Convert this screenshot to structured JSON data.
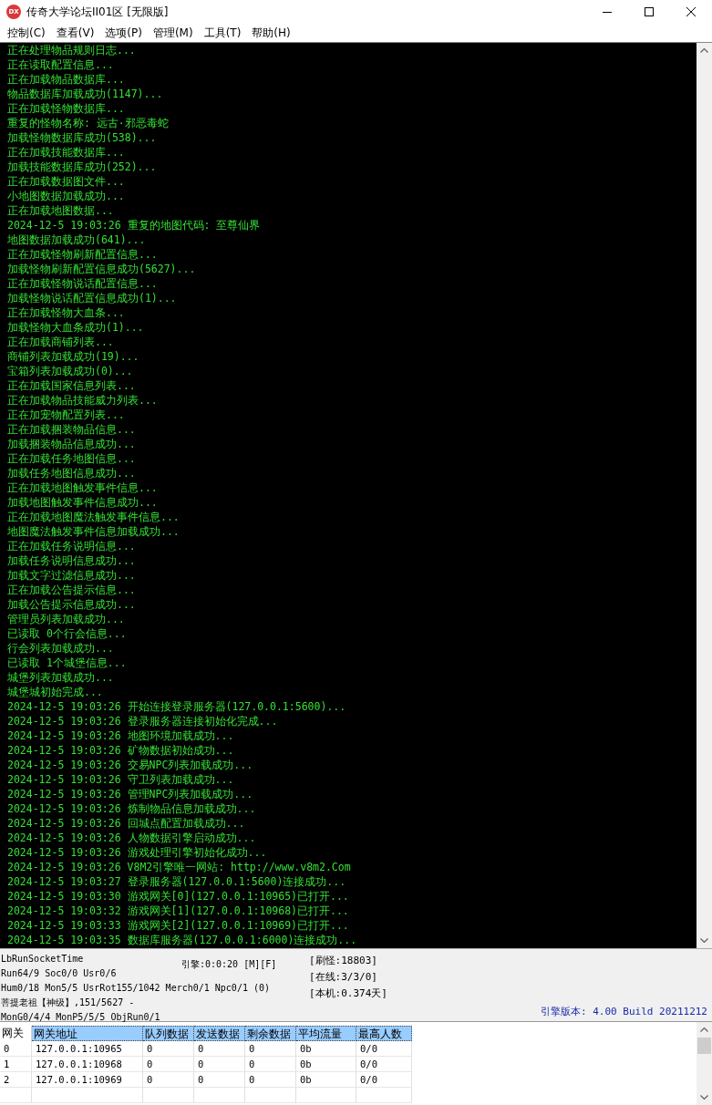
{
  "window": {
    "title": "传奇大学论坛II01区 [无限版]",
    "icon_label": "DX"
  },
  "menu": [
    "控制(C)",
    "查看(V)",
    "选项(P)",
    "管理(M)",
    "工具(T)",
    "帮助(H)"
  ],
  "log": [
    "正在处理物品规则日志...",
    "正在读取配置信息...",
    "正在加载物品数据库...",
    "物品数据库加载成功(1147)...",
    "正在加载怪物数据库...",
    "重复的怪物名称: 远古·邪恶毒蛇",
    "加载怪物数据库成功(538)...",
    "正在加载技能数据库...",
    "加载技能数据库成功(252)...",
    "正在加载数据图文件...",
    "小地图数据加载成功...",
    "正在加载地图数据...",
    "2024-12-5 19:03:26 重复的地图代码: 至尊仙界",
    "地图数据加载成功(641)...",
    "正在加载怪物刷新配置信息...",
    "加载怪物刷新配置信息成功(5627)...",
    "正在加载怪物说话配置信息...",
    "加载怪物说话配置信息成功(1)...",
    "正在加载怪物大血条...",
    "加载怪物大血条成功(1)...",
    "正在加载商铺列表...",
    "商铺列表加载成功(19)...",
    "宝箱列表加载成功(0)...",
    "正在加载国家信息列表...",
    "正在加载物品技能威力列表...",
    "正在加宠物配置列表...",
    "正在加载捆装物品信息...",
    "加载捆装物品信息成功...",
    "正在加载任务地图信息...",
    "加载任务地图信息成功...",
    "正在加载地图触发事件信息...",
    "加载地图触发事件信息成功...",
    "正在加载地图魔法触发事件信息...",
    "地图魔法触发事件信息加载成功...",
    "正在加载任务说明信息...",
    "加载任务说明信息成功...",
    "加载文字过滤信息成功...",
    "正在加载公告提示信息...",
    "加载公告提示信息成功...",
    "管理员列表加载成功...",
    "已读取 0个行会信息...",
    "行会列表加载成功...",
    "已读取 1个城堡信息...",
    "城堡列表加载成功...",
    "城堡城初始完成...",
    "2024-12-5 19:03:26 开始连接登录服务器(127.0.0.1:5600)...",
    "2024-12-5 19:03:26 登录服务器连接初始化完成...",
    "2024-12-5 19:03:26 地图环境加载成功...",
    "2024-12-5 19:03:26 矿物数据初始成功...",
    "2024-12-5 19:03:26 交易NPC列表加载成功...",
    "2024-12-5 19:03:26 守卫列表加载成功...",
    "2024-12-5 19:03:26 管理NPC列表加载成功...",
    "2024-12-5 19:03:26 炼制物品信息加载成功...",
    "2024-12-5 19:03:26 回城点配置加载成功...",
    "2024-12-5 19:03:26 人物数据引擎启动成功...",
    "2024-12-5 19:03:26 游戏处理引擎初始化成功...",
    "2024-12-5 19:03:26 V8M2引擎唯一网站: http://www.v8m2.Com",
    "2024-12-5 19:03:27 登录服务器(127.0.0.1:5600)连接成功...",
    "2024-12-5 19:03:30 游戏网关[0](127.0.0.1:10965)已打开...",
    "2024-12-5 19:03:32 游戏网关[1](127.0.0.1:10968)已打开...",
    "2024-12-5 19:03:33 游戏网关[2](127.0.0.1:10969)已打开...",
    "2024-12-5 19:03:35 数据库服务器(127.0.0.1:6000)连接成功..."
  ],
  "status": {
    "left": [
      "LbRunSocketTime",
      "Run64/9 Soc0/0 Usr0/6",
      "Hum0/18 Mon5/5 UsrRot155/1042 Merch0/1 Npc0/1 (0)",
      "菩提老祖【神级】,151/5627 -",
      "MonG0/4/4 MonP5/5/5 ObjRun0/1"
    ],
    "engine": "引擎:0:0:20 [M][F]",
    "right": [
      "[刷怪:18803]",
      "[在线:3/3/0]",
      "[本机:0.374天]"
    ],
    "version": "引擎版本: 4.00 Build 20211212"
  },
  "table": {
    "columns": [
      {
        "label": "网关",
        "selected": false
      },
      {
        "label": "网关地址",
        "selected": true
      },
      {
        "label": "队列数据",
        "selected": true
      },
      {
        "label": "发送数据",
        "selected": true
      },
      {
        "label": "剩余数据",
        "selected": true
      },
      {
        "label": "平均流量",
        "selected": true
      },
      {
        "label": "最高人数",
        "selected": true
      }
    ],
    "rows": [
      [
        "0",
        "127.0.0.1:10965",
        "0",
        "0",
        "0",
        "0b",
        "0/0"
      ],
      [
        "1",
        "127.0.0.1:10968",
        "0",
        "0",
        "0",
        "0b",
        "0/0"
      ],
      [
        "2",
        "127.0.0.1:10969",
        "0",
        "0",
        "0",
        "0b",
        "0/0"
      ]
    ]
  }
}
